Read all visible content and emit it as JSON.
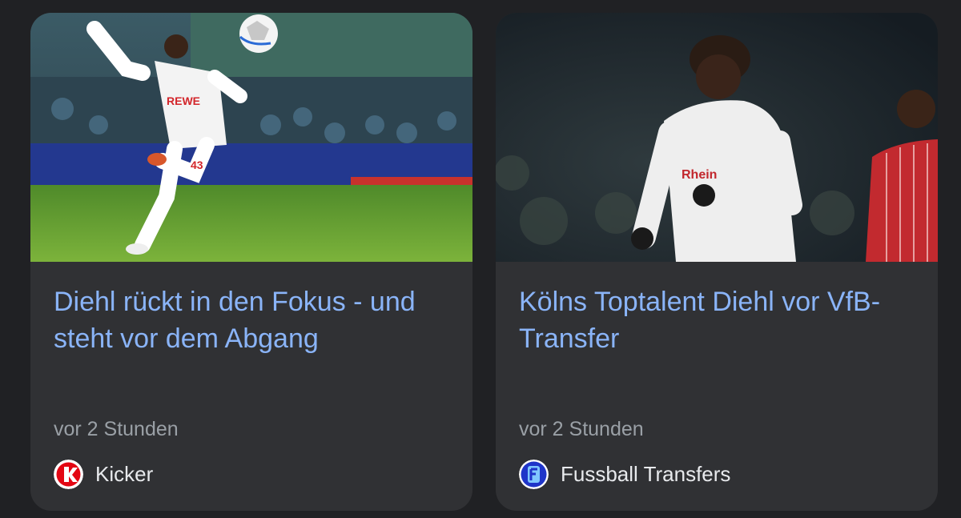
{
  "cards": [
    {
      "headline": "Diehl rückt in den Fokus - und steht vor dem Abgang",
      "time": "vor 2 Stunden",
      "source": "Kicker",
      "logo_icon": "kicker-logo-icon",
      "image_icon": "footballer-kicking-ball-photo",
      "jersey_text": "REWE",
      "jersey_number": "43"
    },
    {
      "headline": "Kölns Toptalent Diehl vor VfB-Transfer",
      "time": "vor 2 Stunden",
      "source": "Fussball Transfers",
      "logo_icon": "fussball-transfers-logo-icon",
      "image_icon": "footballer-running-photo",
      "jersey_text": "Rhein"
    }
  ],
  "colors": {
    "background": "#202124",
    "card": "#303134",
    "headline": "#8ab4f8",
    "secondary_text": "#9aa0a6",
    "source_text": "#e8eaed",
    "kicker_red": "#e30613",
    "transfers_blue": "#1f35c9"
  }
}
